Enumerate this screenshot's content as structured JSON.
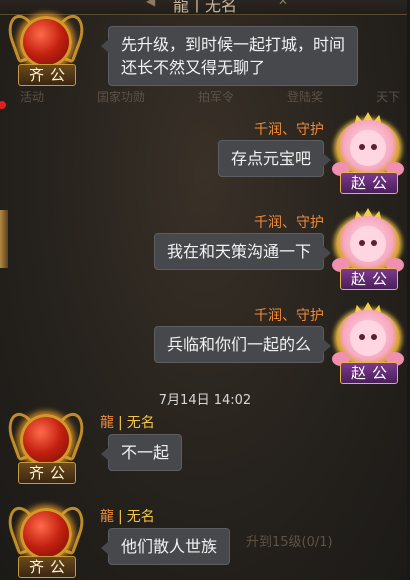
{
  "header": {
    "title": "龍丨无名",
    "nav_left": "◀",
    "nav_right": "✕"
  },
  "background_menu": [
    "活动",
    "国家功勋",
    "拍军令",
    "登陆奖",
    "天下"
  ],
  "background_task": "升到15级(0/1)",
  "timestamp": "7月14日 14:02",
  "messages": [
    {
      "side": "left",
      "sender_title": "龍丨无名",
      "avatar_name": "齐公",
      "lines": [
        "先升级，到时候一起打城，时间",
        "还长不然又得无聊了"
      ]
    },
    {
      "side": "right",
      "sender": "千润、守护",
      "avatar_name": "赵公",
      "lines": [
        "存点元宝吧"
      ]
    },
    {
      "side": "right",
      "sender": "千润、守护",
      "avatar_name": "赵公",
      "lines": [
        "我在和天策沟通一下"
      ]
    },
    {
      "side": "right",
      "sender": "千润、守护",
      "avatar_name": "赵公",
      "lines": [
        "兵临和你们一起的么"
      ]
    },
    {
      "side": "left",
      "sender_name": "龍",
      "sender_suffix": "无名",
      "avatar_name": "齐公",
      "lines": [
        "不一起"
      ]
    },
    {
      "side": "left",
      "sender_name": "龍",
      "sender_suffix": "无名",
      "avatar_name": "齐公",
      "lines": [
        "他们散人世族"
      ]
    }
  ],
  "colors": {
    "sender_name": "#f08a3a",
    "bubble_bg": "#46484c",
    "left_plate": "#6b4a1c",
    "right_plate": "#7c3a8e"
  }
}
